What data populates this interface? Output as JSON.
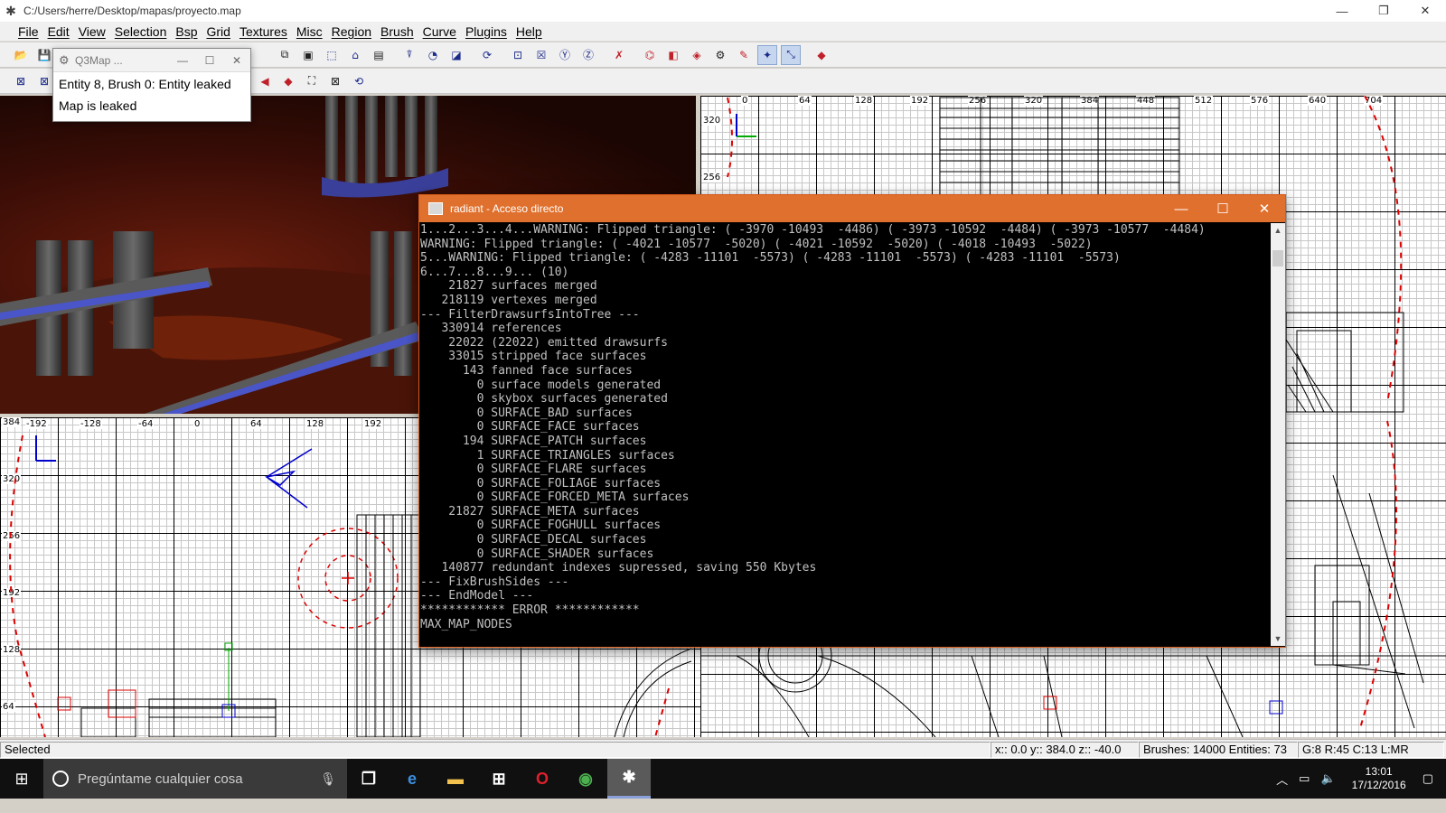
{
  "window": {
    "title": "C:/Users/herre/Desktop/mapas/proyecto.map",
    "minimize": "—",
    "restore": "❐",
    "close": "✕"
  },
  "menu": [
    "File",
    "Edit",
    "View",
    "Selection",
    "Bsp",
    "Grid",
    "Textures",
    "Misc",
    "Region",
    "Brush",
    "Curve",
    "Plugins",
    "Help"
  ],
  "toolbar1": [
    "open-icon",
    "save-icon",
    "flip-x-icon",
    "flip-y-icon",
    "rotate-icon",
    "clipper-icon",
    "select-icon",
    "view-xy-icon",
    "view-xz-icon",
    "view-yz-icon",
    "csg-icon",
    "patch-icon",
    "texture-lock-icon",
    "curve-icon"
  ],
  "toolbar2": [
    "entity-icon",
    "hide-icon",
    "camera-icon",
    "filter-icon"
  ],
  "q3map": {
    "title": "Q3Map ...",
    "lines": [
      "Entity 8, Brush 0: Entity leaked",
      "Map is leaked"
    ]
  },
  "console": {
    "title": "radiant - Acceso directo",
    "lines": [
      "1...2...3...4...WARNING: Flipped triangle: ( -3970 -10493  -4486) ( -3973 -10592  -4484) ( -3973 -10577  -4484)",
      "WARNING: Flipped triangle: ( -4021 -10577  -5020) ( -4021 -10592  -5020) ( -4018 -10493  -5022)",
      "5...WARNING: Flipped triangle: ( -4283 -11101  -5573) ( -4283 -11101  -5573) ( -4283 -11101  -5573)",
      "6...7...8...9... (10)",
      "    21827 surfaces merged",
      "   218119 vertexes merged",
      "--- FilterDrawsurfsIntoTree ---",
      "   330914 references",
      "    22022 (22022) emitted drawsurfs",
      "    33015 stripped face surfaces",
      "      143 fanned face surfaces",
      "        0 surface models generated",
      "        0 skybox surfaces generated",
      "        0 SURFACE_BAD surfaces",
      "        0 SURFACE_FACE surfaces",
      "      194 SURFACE_PATCH surfaces",
      "        1 SURFACE_TRIANGLES surfaces",
      "        0 SURFACE_FLARE surfaces",
      "        0 SURFACE_FOLIAGE surfaces",
      "        0 SURFACE_FORCED_META surfaces",
      "    21827 SURFACE_META surfaces",
      "        0 SURFACE_FOGHULL surfaces",
      "        0 SURFACE_DECAL surfaces",
      "        0 SURFACE_SHADER surfaces",
      "   140877 redundant indexes supressed, saving 550 Kbytes",
      "--- FixBrushSides ---",
      "--- EndModel ---",
      "************ ERROR ************",
      "MAX_MAP_NODES"
    ]
  },
  "grid_top": {
    "x_labels": [
      "0",
      "64",
      "128",
      "192",
      "256",
      "320",
      "384",
      "448",
      "512",
      "576",
      "640",
      "704"
    ],
    "y_labels": [
      "320",
      "256"
    ]
  },
  "grid_bottom": {
    "x_labels": [
      "-192",
      "-128",
      "-64",
      "0",
      "64",
      "128",
      "192"
    ],
    "y_labels": [
      "384",
      "320",
      "256",
      "192",
      "128",
      "64"
    ],
    "right_labels": [
      "640",
      "704"
    ]
  },
  "status": {
    "selected": "Selected",
    "coords": "x:: 0.0  y:: 384.0  z:: -40.0",
    "counts": "Brushes: 14000 Entities: 73",
    "grid": "G:8 R:45 C:13 L:MR"
  },
  "taskbar": {
    "search_placeholder": "Pregúntame cualquier cosa",
    "time": "13:01",
    "date": "17/12/2016"
  }
}
